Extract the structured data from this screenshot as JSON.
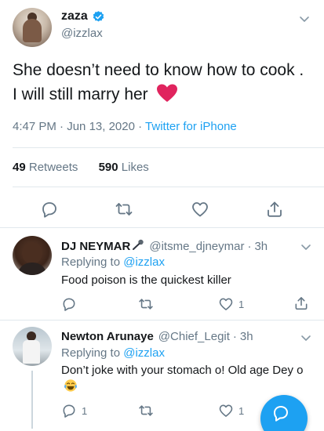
{
  "colors": {
    "accent": "#1da1f2",
    "secondary_text": "#657786",
    "primary_text": "#14171a",
    "divider": "#e1e8ed",
    "heart": "#e0245e"
  },
  "main_tweet": {
    "author_name": "zaza",
    "author_handle": "@izzlax",
    "text": "She doesn’t need to know how to cook . I will still marry her",
    "emoji": "red-heart",
    "time": "4:47 PM",
    "date": "Jun 13, 2020",
    "source": "Twitter for iPhone",
    "retweets_count": "49",
    "retweets_label": "Retweets",
    "likes_count": "590",
    "likes_label": "Likes"
  },
  "replies": [
    {
      "author_name": "DJ NEYMAR",
      "name_emoji": "microphone",
      "author_handle": "@itsme_djneymar",
      "time": "3h",
      "replying_prefix": "Replying to",
      "replying_to": "@izzlax",
      "text": "Food poison is the quickest killer",
      "reply_count": "",
      "like_count": "1"
    },
    {
      "author_name": "Newton Arunaye",
      "author_handle": "@Chief_Legit",
      "time": "3h",
      "replying_prefix": "Replying to",
      "replying_to": "@izzlax",
      "text": "Don’t joke with your stomach o! Old age Dey o",
      "text_emoji": "face-with-tears-of-joy",
      "reply_count": "1",
      "like_count": "1"
    }
  ],
  "icons": [
    "verified-badge",
    "chevron-down",
    "reply",
    "retweet",
    "like",
    "share",
    "compose"
  ]
}
